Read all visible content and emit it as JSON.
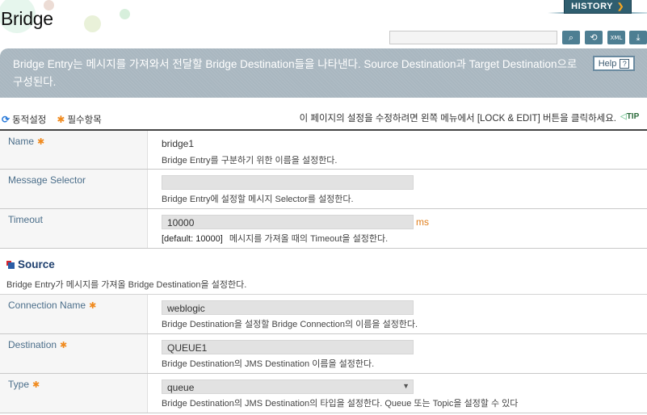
{
  "page": {
    "title": "Bridge",
    "history_label": "HISTORY",
    "search": {
      "value": "",
      "placeholder": ""
    },
    "toolbar": [
      {
        "name": "search-icon",
        "glyph": "🔍"
      },
      {
        "name": "refresh-icon",
        "glyph": "⟲"
      },
      {
        "name": "xml-export-icon",
        "glyph": "⇪"
      },
      {
        "name": "download-icon",
        "glyph": "⤓"
      }
    ]
  },
  "banner": {
    "text": "Bridge Entry는 메시지를 가져와서 전달할 Bridge Destination들을 나타낸다. Source Destination과 Target Destination으로 구성된다.",
    "help_label": "Help",
    "help_icon": "?"
  },
  "legend": {
    "dynamic_icon": "⟳",
    "dynamic_label": "동적설정",
    "required_icon": "✱",
    "required_label": "필수항목"
  },
  "tip": {
    "text": "이 페이지의 설정을 수정하려면 왼쪽 메뉴에서 [LOCK & EDIT] 버튼을 클릭하세요.",
    "badge": "TIP",
    "arrow": "◁"
  },
  "required_mark": "✱",
  "fields": {
    "name": {
      "label": "Name",
      "value": "bridge1",
      "desc": "Bridge Entry를 구분하기 위한 이름을 설정한다."
    },
    "selector": {
      "label": "Message Selector",
      "value": "",
      "desc": "Bridge Entry에 설정할 메시지 Selector를 설정한다."
    },
    "timeout": {
      "label": "Timeout",
      "value": "10000",
      "unit": "ms",
      "default": "[default: 10000]",
      "desc": "메시지를 가져올 때의 Timeout을 설정한다."
    }
  },
  "source": {
    "title": "Source",
    "desc": "Bridge Entry가 메시지를 가져올 Bridge Destination을 설정한다.",
    "connection": {
      "label": "Connection Name",
      "value": "weblogic",
      "desc": "Bridge Destination을 설정할 Bridge Connection의 이름을 설정한다."
    },
    "destination": {
      "label": "Destination",
      "value": "QUEUE1",
      "desc": "Bridge Destination의 JMS Destination 이름을 설정한다."
    },
    "type": {
      "label": "Type",
      "value": "queue",
      "arrow": "▼",
      "desc": "Bridge Destination의 JMS Destination의 타입을 설정한다. Queue 또는 Topic을 설정할 수 있다"
    }
  }
}
